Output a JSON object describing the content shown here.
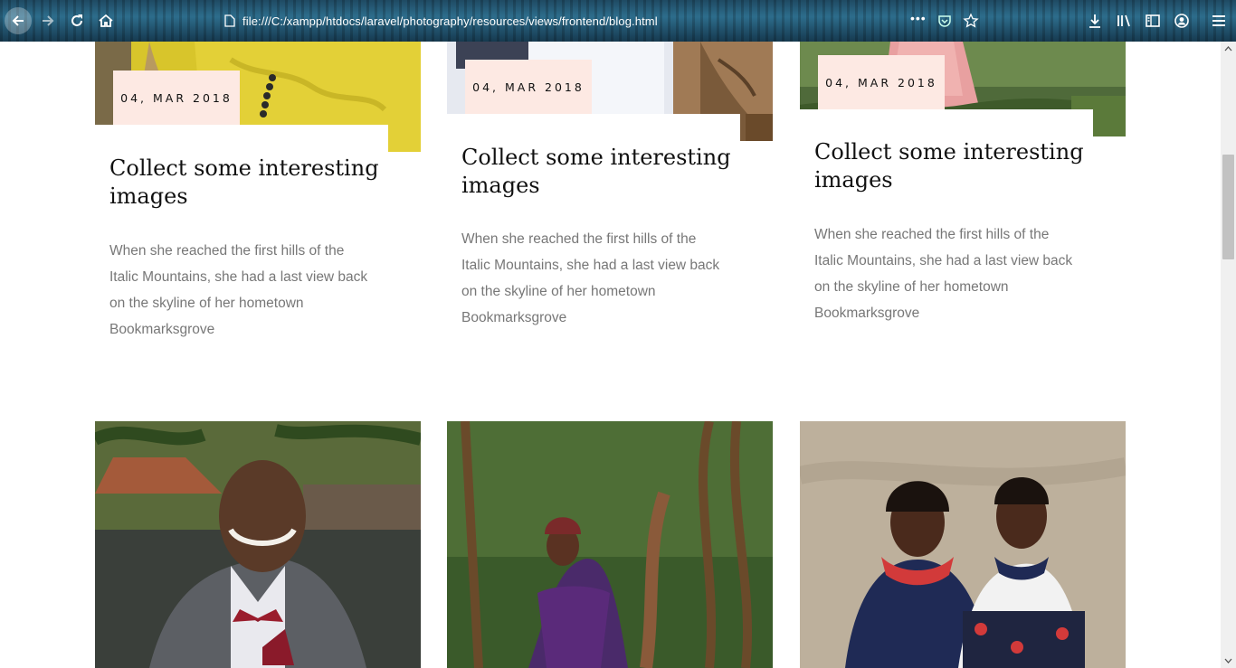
{
  "browser": {
    "url": "file:///C:/xampp/htdocs/laravel/photography/resources/views/frontend/blog.html",
    "page_actions_label": "•••",
    "icons": [
      "back-icon",
      "forward-icon",
      "reload-icon",
      "home-icon",
      "page-icon",
      "pocket-icon",
      "bookmark-star-icon",
      "downloads-icon",
      "library-icon",
      "sidebar-icon",
      "account-icon",
      "menu-icon"
    ]
  },
  "posts": [
    {
      "date": "04, MAR 2018",
      "title": "Collect some interesting images",
      "excerpt": "When she reached the first hills of the Italic Mountains, she had a last view back on the skyline of her hometown Bookmarksgrove"
    },
    {
      "date": "04, MAR 2018",
      "title": "Collect some interesting images",
      "excerpt": "When she reached the first hills of the Italic Mountains, she had a last view back on the skyline of her hometown Bookmarksgrove"
    },
    {
      "date": "04, MAR 2018",
      "title": "Collect some interesting images",
      "excerpt": "When she reached the first hills of the Italic Mountains, she had a last view back on the skyline of her hometown Bookmarksgrove"
    }
  ],
  "photos": [
    "man-in-grey-suit-photo",
    "woman-in-purple-dress-photo",
    "two-women-photo"
  ],
  "colors": {
    "date_badge": "#fde9e3",
    "title": "#111111",
    "excerpt": "#777777"
  }
}
